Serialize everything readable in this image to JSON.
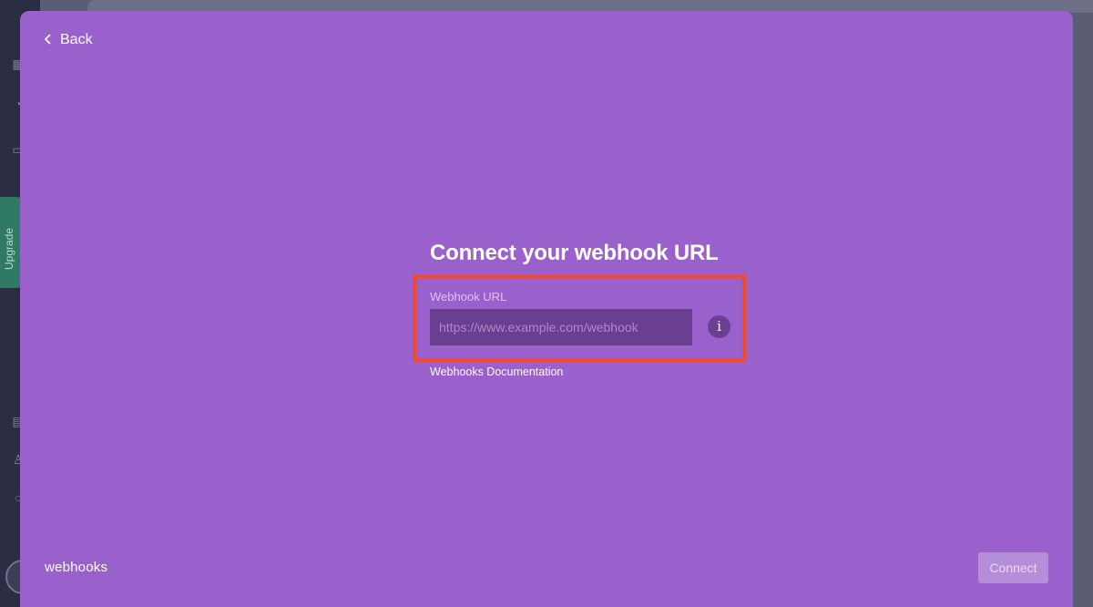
{
  "background_app": {
    "upgrade_label": "Upgrade",
    "sidebar_icons": [
      "grid-icon",
      "bell-icon",
      "inbox-icon",
      "calendar-icon",
      "people-icon",
      "search-icon"
    ]
  },
  "modal": {
    "back_label": "Back",
    "title": "Connect your webhook URL",
    "field": {
      "label": "Webhook URL",
      "value": "",
      "placeholder": "https://www.example.com/webhook",
      "info_glyph": "i"
    },
    "docs_link": "Webhooks Documentation",
    "brand": "webhooks",
    "connect_label": "Connect"
  },
  "colors": {
    "modal_bg": "#9a60cc",
    "input_bg": "#6a3f91",
    "highlight": "#f04a2a",
    "connect_disabled_bg": "#b48edb"
  }
}
